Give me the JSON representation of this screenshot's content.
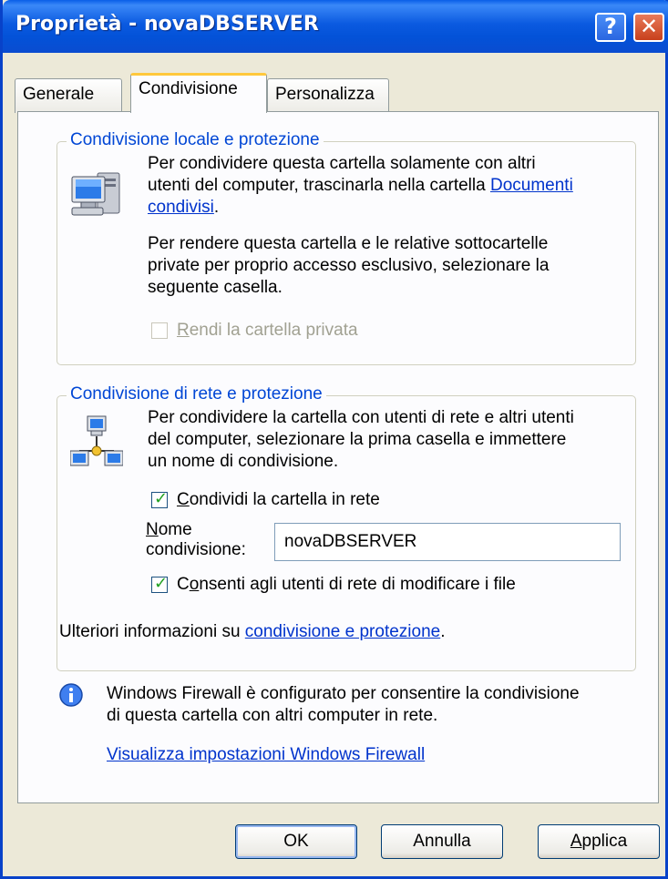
{
  "window": {
    "title": "Proprietà - novaDBSERVER",
    "help_label": "?",
    "close_label": "✕"
  },
  "tabs": [
    {
      "label": "Generale",
      "active": false
    },
    {
      "label": "Condivisione",
      "active": true
    },
    {
      "label": "Personalizza",
      "active": false
    }
  ],
  "local_group": {
    "legend": "Condivisione locale e protezione",
    "icon": "computer-icon",
    "text_a": "Per condividere questa cartella solamente con altri",
    "text_b": "utenti del computer, trascinarla nella cartella",
    "link_a": "Documenti",
    "link_b": "condivisi",
    "period": ".",
    "para2": [
      "Per rendere questa cartella e le relative sottocartelle",
      "private per proprio accesso esclusivo, selezionare la",
      "seguente casella."
    ],
    "private_checkbox": {
      "label_accel": "R",
      "label_rest": "endi la cartella privata",
      "checked": false,
      "enabled": false
    }
  },
  "network_group": {
    "legend": "Condivisione di rete e protezione",
    "icon": "network-share-icon",
    "para": [
      "Per condividere la cartella con utenti di rete e altri utenti",
      "del computer, selezionare la prima casella e immettere",
      "un nome di condivisione."
    ],
    "share_checkbox": {
      "label_accel": "C",
      "label_rest": "ondividi la cartella in rete",
      "checked": true
    },
    "share_name_label_accel": "N",
    "share_name_label_rest": "ome",
    "share_name_label_line2": "condivisione:",
    "share_name_value": "novaDBSERVER",
    "modify_checkbox": {
      "label_pre": "C",
      "label_accel": "o",
      "label_rest": "nsenti agli utenti di rete di modificare i file",
      "checked": true
    },
    "more_info_text": "Ulteriori informazioni su ",
    "more_info_link": "condivisione e protezione",
    "more_info_period": "."
  },
  "firewall": {
    "icon": "info-icon",
    "text": [
      "Windows Firewall è configurato per consentire la condivisione",
      "di questa cartella con altri computer in rete."
    ],
    "link": "Visualizza impostazioni Windows Firewall"
  },
  "buttons": {
    "ok": "OK",
    "cancel": "Annulla",
    "apply_accel": "A",
    "apply_rest": "pplica"
  },
  "colors": {
    "title_bar": "#0a5fe8",
    "dialog_bg": "#ece9d8",
    "legend": "#0046d5",
    "link": "#0033cc",
    "check": "#21a121"
  }
}
